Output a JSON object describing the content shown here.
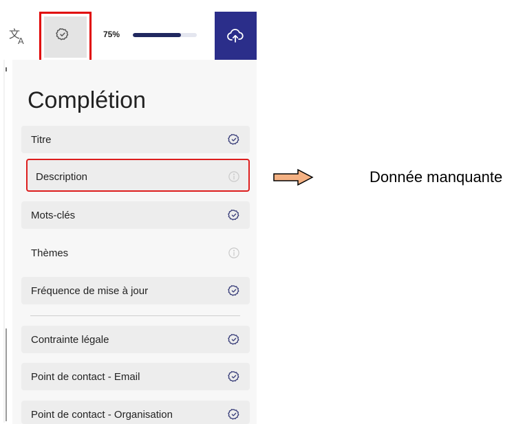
{
  "toolbar": {
    "translate_icon": "translate-icon",
    "completion_icon": "badge-check-icon",
    "progress_label": "75%",
    "progress_value": 0.75,
    "upload_icon": "cloud-upload-icon"
  },
  "panel": {
    "title": "Complétion",
    "items": [
      {
        "label": "Titre",
        "status": "complete"
      },
      {
        "label": "Description",
        "status": "missing"
      },
      {
        "label": "Mots-clés",
        "status": "complete"
      },
      {
        "label": "Thèmes",
        "status": "missing"
      },
      {
        "label": "Fréquence de mise à jour",
        "status": "complete"
      },
      {
        "label": "Contrainte légale",
        "status": "complete"
      },
      {
        "label": "Point de contact - Email",
        "status": "complete"
      },
      {
        "label": "Point de contact - Organisation",
        "status": "complete"
      }
    ]
  },
  "annotation": {
    "text": "Donnée manquante"
  },
  "colors": {
    "accent": "#2b2e8a",
    "progress_fill": "#20285f",
    "highlight": "#dd1d1d",
    "arrow_fill": "#f4b183"
  }
}
